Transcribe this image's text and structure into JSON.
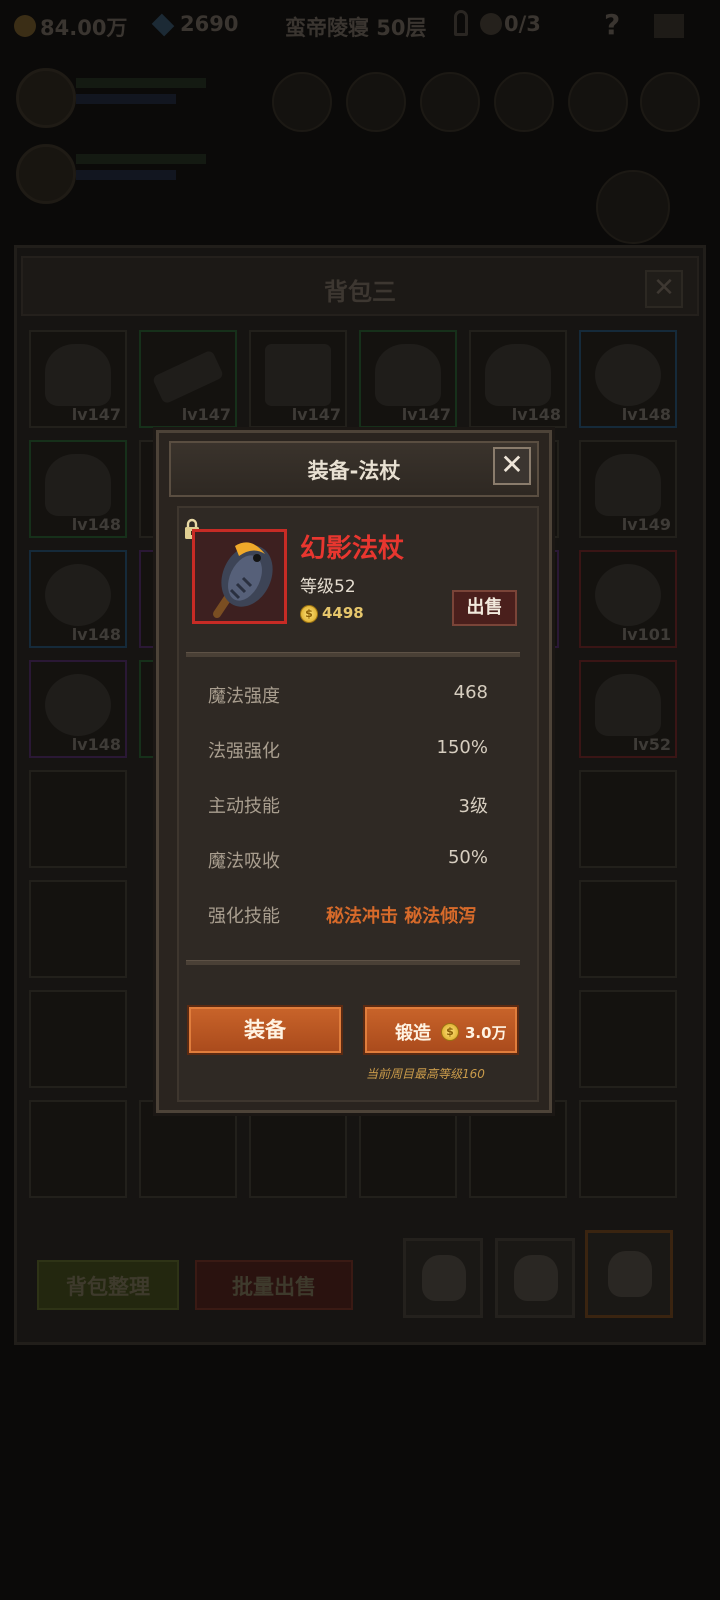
{
  "topbar": {
    "gold": "84.00万",
    "gems": "2690",
    "location": "蛮帝陵寝 50层",
    "keys": "0/3",
    "help": "?"
  },
  "bag": {
    "title": "背包三",
    "close": "✕",
    "items": [
      {
        "level": "lv147",
        "rarity": "gray"
      },
      {
        "level": "lv147",
        "rarity": "green"
      },
      {
        "level": "lv147",
        "rarity": "gray"
      },
      {
        "level": "lv147",
        "rarity": "green"
      },
      {
        "level": "lv148",
        "rarity": "gray"
      },
      {
        "level": "lv148",
        "rarity": "blue"
      },
      {
        "level": "lv148",
        "rarity": "green"
      },
      {
        "level": "lv149",
        "rarity": "gray"
      },
      {
        "level": "lv148",
        "rarity": "blue"
      },
      {
        "level": "lv101",
        "rarity": "red"
      },
      {
        "level": "lv148",
        "rarity": "purple"
      },
      {
        "level": "lv52",
        "rarity": "red"
      }
    ],
    "sort_button": "背包整理",
    "bulk_sell_button": "批量出售"
  },
  "modal": {
    "title": "装备-法杖",
    "close": "✕",
    "item": {
      "name": "幻影法杖",
      "level": "等级52",
      "price": "4498",
      "sell_button": "出售"
    },
    "stats": [
      {
        "label": "魔法强度",
        "value": "468"
      },
      {
        "label": "法强强化",
        "value": "150%"
      },
      {
        "label": "主动技能",
        "value": "3级"
      },
      {
        "label": "魔法吸收",
        "value": "50%"
      }
    ],
    "skill": {
      "label": "强化技能",
      "value": "秘法冲击 秘法倾泻"
    },
    "equip_button": "装备",
    "forge_button": "锻造",
    "forge_cost": "3.0万",
    "note": "当前周目最高等级160"
  },
  "colors": {
    "item_name": "#e8362f",
    "skill_text": "#d76a2a",
    "button_orange": "#c9642a",
    "price_gold": "#e6c66c"
  }
}
